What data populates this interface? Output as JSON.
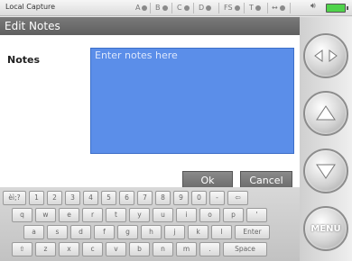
{
  "status_bar": {
    "title": "Local Capture",
    "indicators": [
      {
        "label": "A"
      },
      {
        "label": "B"
      },
      {
        "label": "C"
      },
      {
        "label": "D"
      },
      {
        "label": "FS"
      },
      {
        "label": "T"
      },
      {
        "label": "↔"
      }
    ],
    "audio_icon": "speaker-icon",
    "battery_icon": "battery-icon"
  },
  "dialog": {
    "title": "Edit Notes",
    "notes_label": "Notes",
    "notes_placeholder": "Enter notes here",
    "notes_value": "",
    "ok_label": "Ok",
    "cancel_label": "Cancel"
  },
  "keyboard": {
    "row1": [
      "èì;?",
      "1",
      "2",
      "3",
      "4",
      "5",
      "6",
      "7",
      "8",
      "9",
      "0",
      "-",
      "⇦"
    ],
    "row2": [
      "q",
      "w",
      "e",
      "r",
      "t",
      "y",
      "u",
      "i",
      "o",
      "p",
      "'"
    ],
    "row3": [
      "a",
      "s",
      "d",
      "f",
      "g",
      "h",
      "j",
      "k",
      "l",
      "Enter"
    ],
    "row4": [
      "⇧",
      "z",
      "x",
      "c",
      "v",
      "b",
      "n",
      "m",
      ".",
      "Space"
    ]
  },
  "side_controls": {
    "top_icon": "collapse-arrows-icon",
    "up_icon": "up-arrow-icon",
    "down_icon": "down-arrow-icon",
    "menu_label": "MENU"
  },
  "colors": {
    "notes_bg": "#5b8ee9",
    "titlebar": "#6b6b6b",
    "battery": "#4fd34a"
  }
}
